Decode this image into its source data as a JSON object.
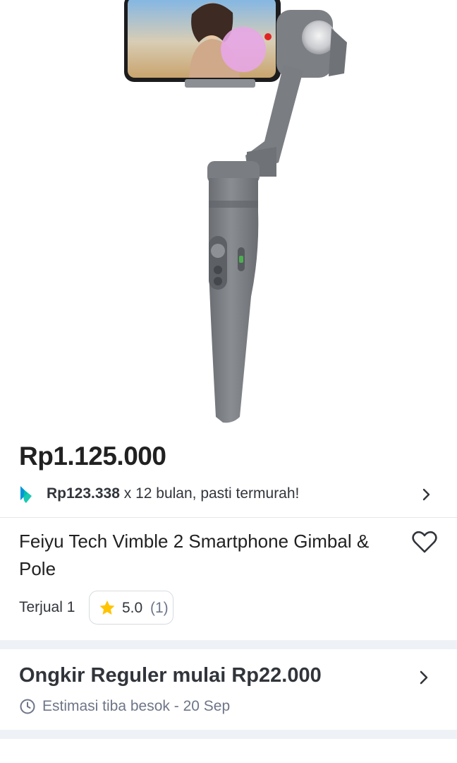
{
  "product": {
    "image_alt": "Feiyu Tech Vimble 2 gimbal product photo",
    "price": "Rp1.125.000",
    "installment": {
      "amount": "Rp123.338",
      "text": " x 12 bulan, pasti termurah!",
      "icon": "paylater-icon"
    },
    "title": "Feiyu Tech Vimble 2 Smartphone Gimbal & Pole",
    "sold": "Terjual 1",
    "rating": "5.0",
    "rating_count": "(1)"
  },
  "shipping": {
    "title": "Ongkir Reguler mulai Rp22.000",
    "eta": "Estimasi tiba besok - 20 Sep"
  },
  "colors": {
    "accent_green": "#03ac0e",
    "paylater_blue": "#0095da",
    "star_yellow": "#ffc400",
    "text_primary": "#212121",
    "text_muted": "#6d7588"
  }
}
